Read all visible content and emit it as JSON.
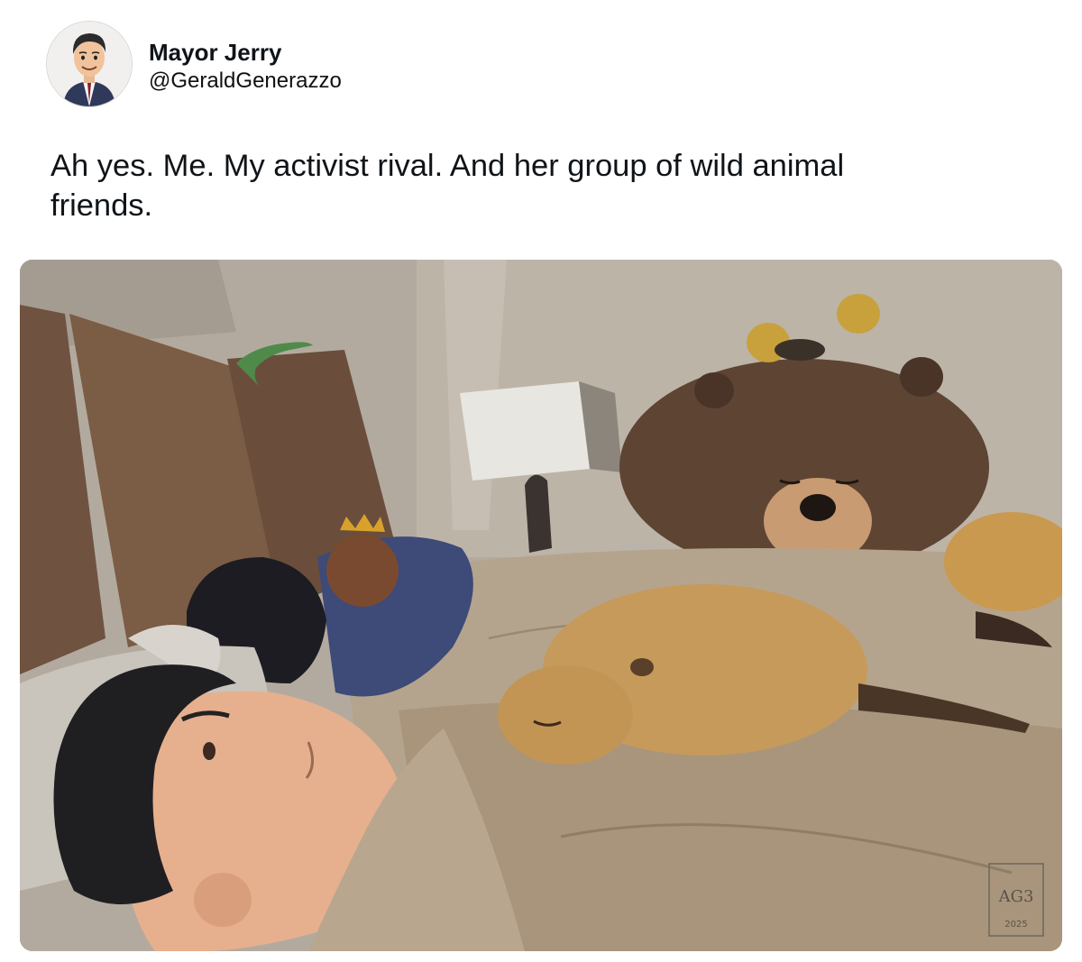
{
  "author": {
    "display_name": "Mayor Jerry",
    "handle": "@GeraldGenerazzo",
    "avatar_icon": "cartoon-man-avatar"
  },
  "tweet": {
    "text": "Ah yes. Me. My activist rival. And her group of wild animal friends."
  },
  "media": {
    "signature_mark": "AG3",
    "signature_year": "2025",
    "colors": {
      "wall": "#b3aa9f",
      "blanket": "#b5a48d",
      "headboard": "#7b5c44",
      "bear": "#5e4433"
    }
  }
}
